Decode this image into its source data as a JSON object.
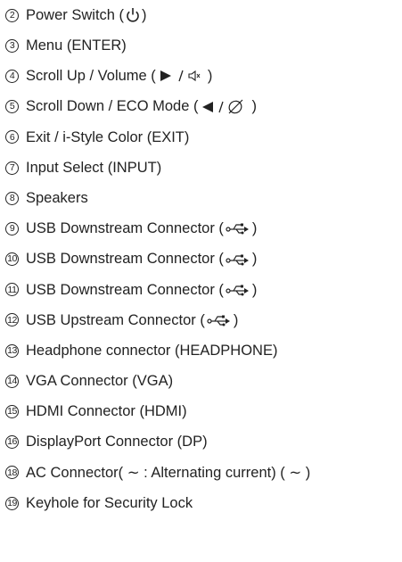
{
  "items": [
    {
      "number": "2",
      "text": "Power Switch (",
      "icon": "power-icon",
      "after": " )"
    },
    {
      "number": "3",
      "text": "Menu (ENTER)"
    },
    {
      "number": "4",
      "text": "Scroll Up / Volume (",
      "icon": "play-volume-icon",
      "after": " )"
    },
    {
      "number": "5",
      "text": "Scroll Down / ECO Mode (",
      "icon": "back-eco-icon",
      "after": " )"
    },
    {
      "number": "6",
      "text": "Exit / i-Style Color (EXIT)"
    },
    {
      "number": "7",
      "text": "Input Select (INPUT)"
    },
    {
      "number": "8",
      "text": "Speakers"
    },
    {
      "number": "9",
      "text": "USB Downstream Connector (",
      "icon": "usb-icon",
      "after": ")"
    },
    {
      "number": "10",
      "text": "USB Downstream Connector (",
      "icon": "usb-icon",
      "after": ")"
    },
    {
      "number": "11",
      "text": "USB Downstream Connector (",
      "icon": "usb-icon",
      "after": ")"
    },
    {
      "number": "12",
      "text": "USB Upstream Connector (",
      "icon": "usb-icon",
      "after": ")"
    },
    {
      "number": "13",
      "text": "Headphone connector (HEADPHONE)"
    },
    {
      "number": "14",
      "text": "VGA Connector (VGA)"
    },
    {
      "number": "15",
      "text": "HDMI Connector (HDMI)"
    },
    {
      "number": "16",
      "text": "DisplayPort Connector (DP)"
    },
    {
      "number": "18",
      "text": "AC Connector( ∼ : Alternating current) ( ∼ )"
    },
    {
      "number": "19",
      "text": "Keyhole for Security Lock"
    }
  ]
}
